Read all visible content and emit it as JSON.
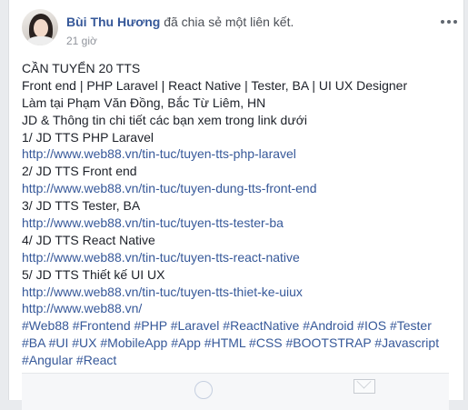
{
  "post": {
    "author": "Bùi Thu Hương",
    "action": "đã chia sẻ một liên kết.",
    "time": "21 giờ"
  },
  "content": {
    "lines": [
      {
        "text": "CẦN TUYỂN 20 TTS",
        "link": false
      },
      {
        "text": "Front end | PHP Laravel | React Native | Tester, BA | UI UX Designer",
        "link": false
      },
      {
        "text": "Làm tại Phạm Văn Đồng, Bắc Từ Liêm, HN",
        "link": false
      },
      {
        "text": "JD & Thông tin chi tiết các bạn xem trong link dưới",
        "link": false
      },
      {
        "text": "1/ JD TTS PHP Laravel",
        "link": false
      },
      {
        "text": "http://www.web88.vn/tin-tuc/tuyen-tts-php-laravel",
        "link": true
      },
      {
        "text": "2/ JD TTS Front end",
        "link": false
      },
      {
        "text": "http://www.web88.vn/tin-tuc/tuyen-dung-tts-front-end",
        "link": true
      },
      {
        "text": "3/ JD TTS Tester, BA",
        "link": false
      },
      {
        "text": "http://www.web88.vn/tin-tuc/tuyen-tts-tester-ba",
        "link": true
      },
      {
        "text": "4/ JD TTS React Native",
        "link": false
      },
      {
        "text": "http://www.web88.vn/tin-tuc/tuyen-tts-react-native",
        "link": true
      },
      {
        "text": "5/ JD TTS Thiết kế UI UX",
        "link": false
      },
      {
        "text": "http://www.web88.vn/tin-tuc/tuyen-tts-thiet-ke-uiux",
        "link": true
      },
      {
        "text": "http://www.web88.vn/",
        "link": true
      },
      {
        "text": "#Web88 #Frontend #PHP #Laravel #ReactNative #Android #IOS #Tester",
        "link": true
      },
      {
        "text": "#BA #UI #UX #MobileApp #App #HTML #CSS #BOOTSTRAP #Javascript",
        "link": true
      },
      {
        "text": "#Angular #React",
        "link": true
      }
    ]
  },
  "icons": {
    "more": "more-options-icon",
    "mail": "envelope-icon"
  }
}
